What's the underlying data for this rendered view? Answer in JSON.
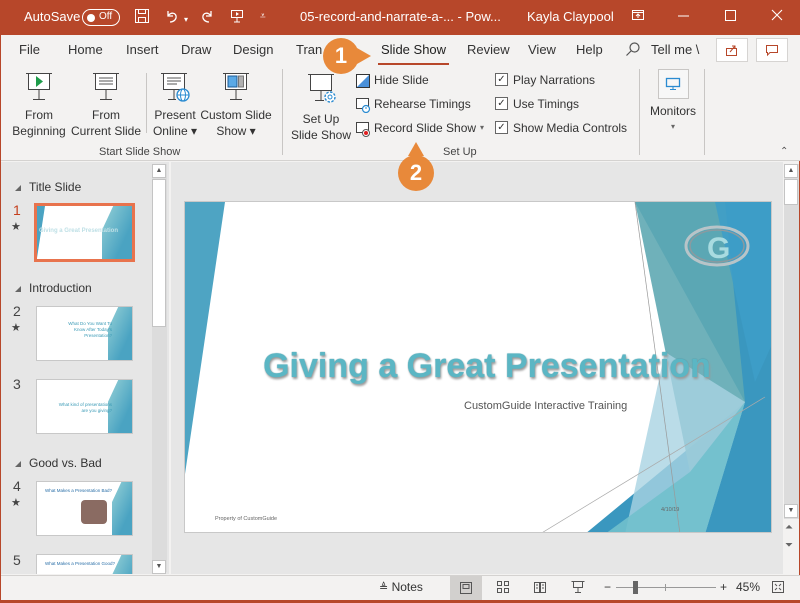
{
  "titlebar": {
    "autosave_label": "AutoSave",
    "autosave_state": "Off",
    "document_title": "05-record-and-narrate-a-...  -  Pow...",
    "user_name": "Kayla Claypool",
    "icons": [
      "save-icon",
      "undo-icon",
      "redo-icon",
      "start-from-beginning-icon",
      "customize-qat-icon",
      "ribbon-display-icon",
      "minimize-icon",
      "maximize-icon",
      "close-icon"
    ]
  },
  "tabs": [
    {
      "label": "File"
    },
    {
      "label": "Home"
    },
    {
      "label": "Insert"
    },
    {
      "label": "Draw"
    },
    {
      "label": "Design"
    },
    {
      "label": "Tran"
    },
    {
      "label": "Slide Show",
      "active": true
    },
    {
      "label": "Review"
    },
    {
      "label": "View"
    },
    {
      "label": "Help"
    }
  ],
  "tell_me": "Tell me \\",
  "ribbon": {
    "start_group": {
      "label": "Start Slide Show",
      "buttons": [
        {
          "line1": "From",
          "line2": "Beginning"
        },
        {
          "line1": "From",
          "line2": "Current Slide"
        },
        {
          "line1": "Present",
          "line2": "Online ▾"
        },
        {
          "line1": "Custom Slide",
          "line2": "Show ▾"
        }
      ]
    },
    "setup_group": {
      "label": "Set Up",
      "setup_button": {
        "line1": "Set Up",
        "line2": "Slide Show"
      },
      "commands": [
        "Hide Slide",
        "Rehearse Timings",
        "Record Slide Show"
      ],
      "checkboxes": [
        {
          "label": "Play Narrations",
          "checked": true
        },
        {
          "label": "Use Timings",
          "checked": true
        },
        {
          "label": "Show Media Controls",
          "checked": true
        }
      ]
    },
    "monitors_group": {
      "label": "Monitors"
    }
  },
  "callouts": {
    "one": "1",
    "two": "2"
  },
  "slide_pane": {
    "sections": [
      "Title Slide",
      "Introduction",
      "Good vs. Bad"
    ],
    "slides": [
      {
        "number": "1",
        "text": "Giving a Great Presentation",
        "selected": true
      },
      {
        "number": "2",
        "text": "What Do You Want To Know After Today's Presentation?"
      },
      {
        "number": "3",
        "text": "What kind of presentations are you giving?"
      },
      {
        "number": "4",
        "text": "What Makes a Presentation Bad?"
      },
      {
        "number": "5",
        "text": "What Makes a Presentation Good?"
      }
    ]
  },
  "slide": {
    "title": "Giving a Great Presentation",
    "subtitle": "CustomGuide Interactive Training",
    "footer": "Property of CustomGuide",
    "date": "4/10/19"
  },
  "statusbar": {
    "notes_label": "Notes",
    "zoom_level": "45%",
    "zoom_fraction": 0.45
  },
  "colors": {
    "accent": "#b7472a",
    "callout": "#e8893a",
    "slide_teal": "#5bb6c4"
  }
}
